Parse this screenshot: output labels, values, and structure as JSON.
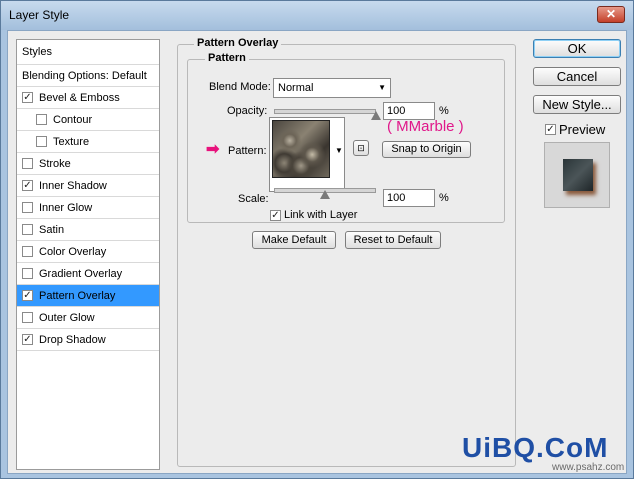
{
  "window": {
    "title": "Layer Style",
    "close_glyph": "✕"
  },
  "left_list": {
    "header": "Styles",
    "blending": "Blending Options: Default",
    "items": [
      {
        "label": "Bevel & Emboss",
        "checked": true,
        "indent": false
      },
      {
        "label": "Contour",
        "checked": false,
        "indent": true
      },
      {
        "label": "Texture",
        "checked": false,
        "indent": true
      },
      {
        "label": "Stroke",
        "checked": false,
        "indent": false
      },
      {
        "label": "Inner Shadow",
        "checked": true,
        "indent": false
      },
      {
        "label": "Inner Glow",
        "checked": false,
        "indent": false
      },
      {
        "label": "Satin",
        "checked": false,
        "indent": false
      },
      {
        "label": "Color Overlay",
        "checked": false,
        "indent": false
      },
      {
        "label": "Gradient Overlay",
        "checked": false,
        "indent": false
      },
      {
        "label": "Pattern Overlay",
        "checked": true,
        "indent": false,
        "selected": true
      },
      {
        "label": "Outer Glow",
        "checked": false,
        "indent": false
      },
      {
        "label": "Drop Shadow",
        "checked": true,
        "indent": false
      }
    ]
  },
  "panel": {
    "outer_title": "Pattern Overlay",
    "inner_title": "Pattern",
    "blend_mode_label": "Blend Mode:",
    "blend_mode_value": "Normal",
    "opacity_label": "Opacity:",
    "opacity_value": "100",
    "opacity_level": 1.0,
    "opacity_unit": "%",
    "pattern_label": "Pattern:",
    "snap_button": "Snap to Origin",
    "scale_label": "Scale:",
    "scale_value": "100",
    "scale_level": 0.5,
    "scale_unit": "%",
    "link_label": "Link with Layer",
    "link_checked": true,
    "make_default": "Make Default",
    "reset_default": "Reset to Default"
  },
  "annotation": {
    "arrow": "➡",
    "text": "( MMarble )"
  },
  "right": {
    "ok": "OK",
    "cancel": "Cancel",
    "new_style": "New Style...",
    "preview_label": "Preview",
    "preview_checked": true
  },
  "watermark": {
    "main": "UiBQ.CoM",
    "sub": "www.psahz.com"
  },
  "colors": {
    "selection": "#3399ff",
    "annotation": "#e0178a",
    "watermark": "#1f4fa5"
  }
}
